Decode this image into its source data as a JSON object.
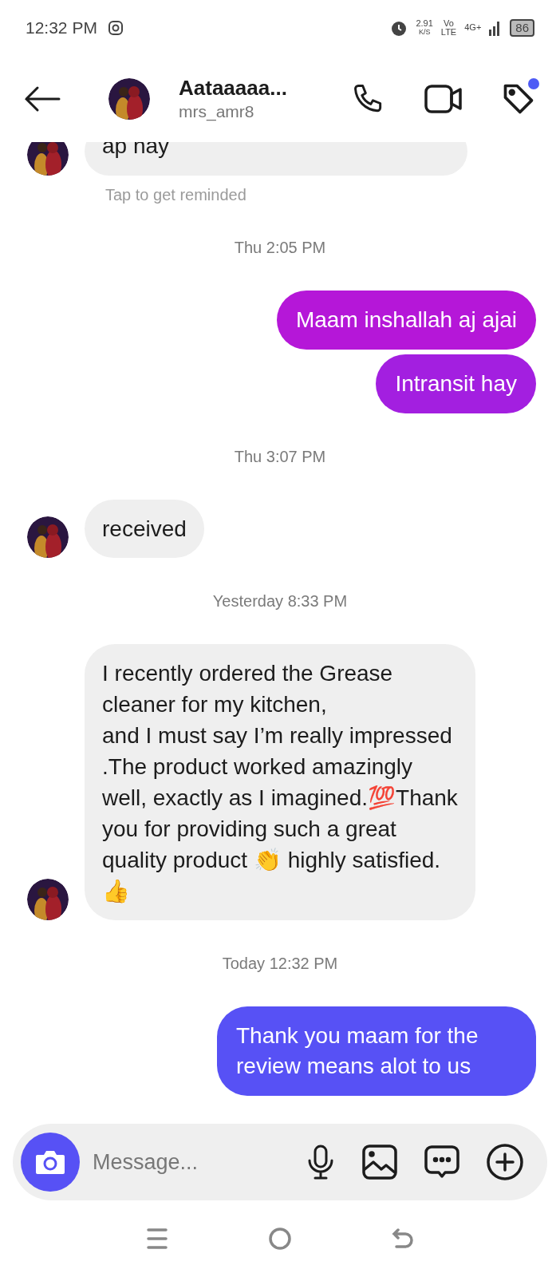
{
  "status_bar": {
    "time": "12:32 PM",
    "speed": "2.91",
    "speed_unit": "K/S",
    "volte_top": "Vo",
    "volte_bottom": "LTE",
    "network": "4G+",
    "battery": "86"
  },
  "header": {
    "name": "Aataaaaa...",
    "username": "mrs_amr8",
    "tag_badge": true
  },
  "messages": [
    {
      "kind": "incoming",
      "text": "ap nay",
      "avatar": true,
      "cut": true
    },
    {
      "kind": "note",
      "text": "Tap to get reminded"
    },
    {
      "kind": "timestamp",
      "text": "Thu 2:05 PM"
    },
    {
      "kind": "outgoing",
      "text": "Maam inshallah aj ajai",
      "color": "#b517d8"
    },
    {
      "kind": "outgoing",
      "text": "Intransit hay",
      "color": "#a31fe0"
    },
    {
      "kind": "timestamp",
      "text": "Thu 3:07 PM"
    },
    {
      "kind": "incoming",
      "text": "received",
      "avatar": true
    },
    {
      "kind": "timestamp",
      "text": "Yesterday 8:33 PM"
    },
    {
      "kind": "incoming",
      "text": "I recently ordered the Grease cleaner for my kitchen,\nand I must say I’m really impressed .The product worked amazingly well, exactly as I imagined.💯Thank you for providing such a great quality product 👏 highly satisfied. 👍",
      "avatar": true
    },
    {
      "kind": "timestamp",
      "text": "Today 12:32 PM"
    },
    {
      "kind": "outgoing",
      "text": "Thank you maam for the review means alot to us",
      "color": "#5751f5"
    }
  ],
  "composer": {
    "placeholder": "Message..."
  }
}
